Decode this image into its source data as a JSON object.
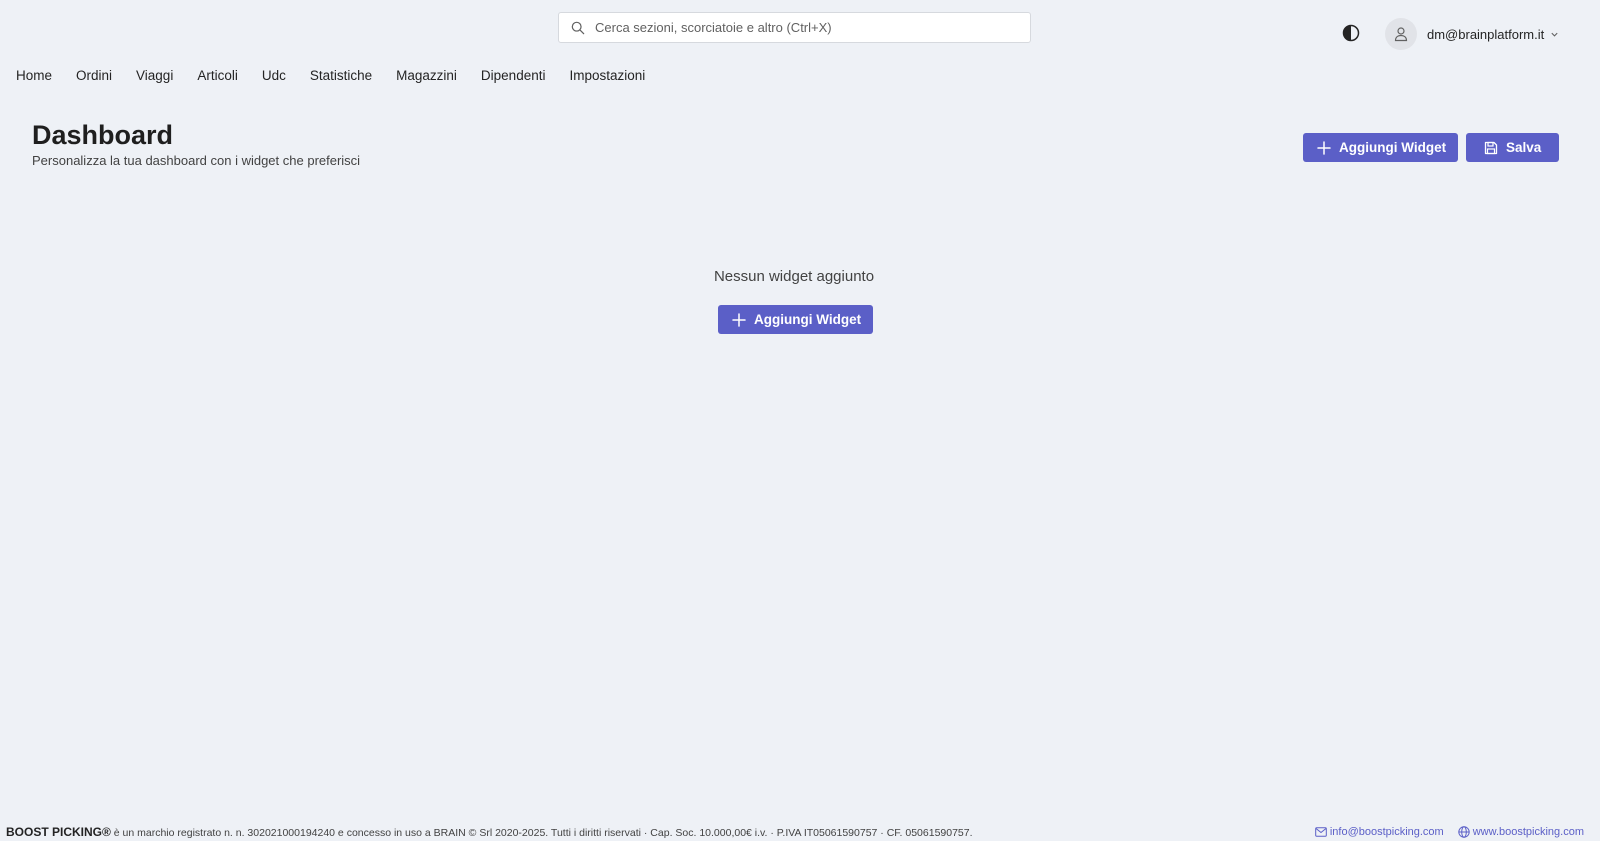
{
  "search": {
    "placeholder": "Cerca sezioni, scorciatoie e altro (Ctrl+X)"
  },
  "user": {
    "email": "dm@brainplatform.it"
  },
  "nav": {
    "items": [
      "Home",
      "Ordini",
      "Viaggi",
      "Articoli",
      "Udc",
      "Statistiche",
      "Magazzini",
      "Dipendenti",
      "Impostazioni"
    ]
  },
  "header": {
    "title": "Dashboard",
    "subtitle": "Personalizza la tua dashboard con i widget che preferisci"
  },
  "toolbar": {
    "add_widget_label": "Aggiungi Widget",
    "save_label": "Salva"
  },
  "empty_state": {
    "message": "Nessun widget aggiunto",
    "add_widget_label": "Aggiungi Widget"
  },
  "footer": {
    "brand": "BOOST PICKING®",
    "legal": " è un marchio registrato n. n. 302021000194240 e concesso in uso a BRAIN © Srl 2020-2025. Tutti i diritti riservati · Cap. Soc. 10.000,00€ i.v. · P.IVA IT05061590757 · CF. 05061590757.",
    "email": "info@boostpicking.com",
    "website": "www.boostpicking.com"
  },
  "colors": {
    "background": "#eef1f6",
    "accent": "#5b5fc7"
  },
  "icons": {
    "search": "search-icon",
    "theme": "contrast-icon",
    "user": "person-icon",
    "chevron": "chevron-down-icon",
    "add": "plus-icon",
    "save": "floppy-disk-icon",
    "mail": "mail-icon",
    "globe": "globe-icon"
  }
}
